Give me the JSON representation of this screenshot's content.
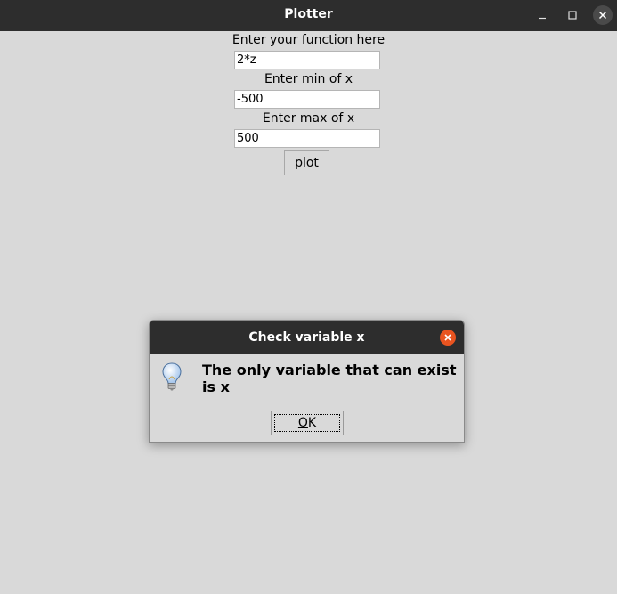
{
  "window": {
    "title": "Plotter",
    "minimize_icon": "minimize-icon",
    "maximize_icon": "maximize-icon",
    "close_icon": "close-icon"
  },
  "form": {
    "function_label": "Enter your function here",
    "function_value": "2*z",
    "min_label": "Enter min of x",
    "min_value": "-500",
    "max_label": "Enter max of x",
    "max_value": "500",
    "plot_button": "plot"
  },
  "dialog": {
    "title": "Check variable x",
    "message": "The only variable that can exist is x",
    "ok_mnemonic": "O",
    "ok_rest": "K",
    "icon": "lightbulb-icon",
    "close_icon": "close-icon",
    "close_color": "#e95420"
  },
  "colors": {
    "titlebar": "#2d2d2d",
    "background": "#d9d9d9",
    "accent": "#e95420"
  }
}
